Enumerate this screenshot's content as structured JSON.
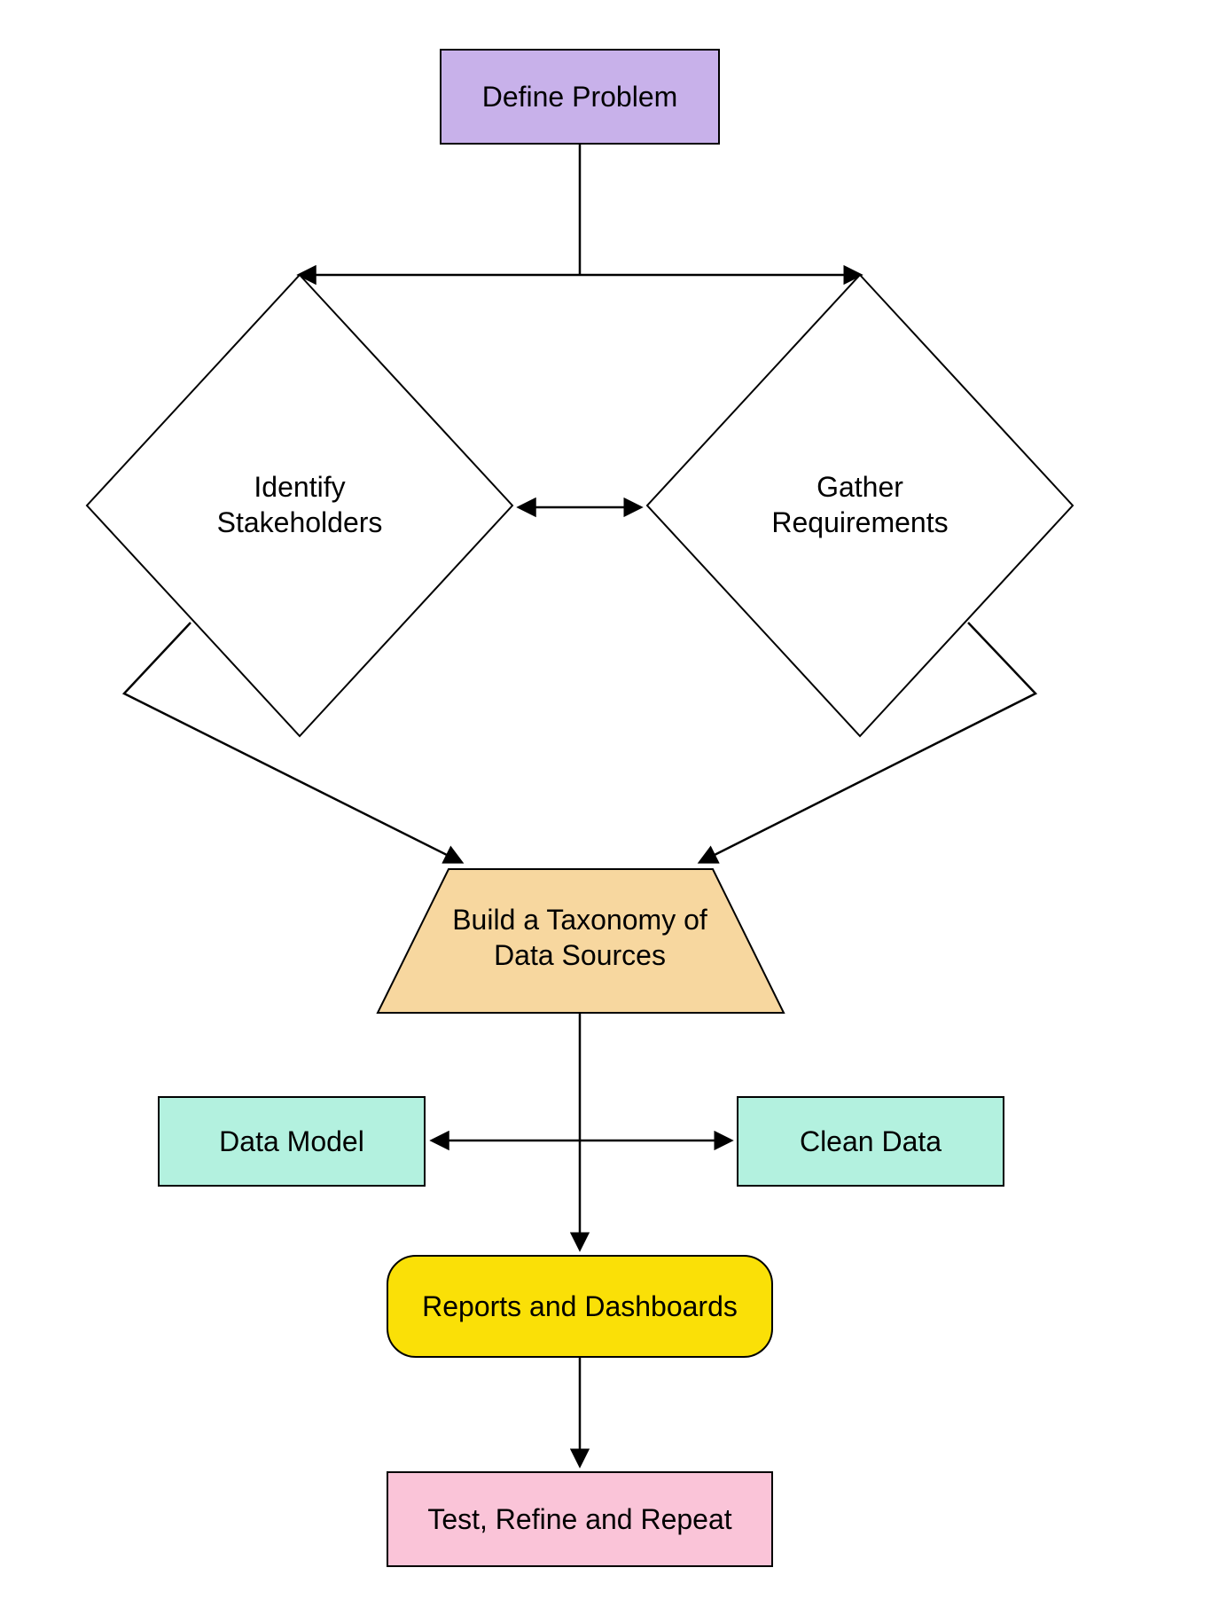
{
  "nodes": {
    "define_problem": {
      "label": "Define Problem",
      "shape": "rect",
      "fill": "#c8b1ea"
    },
    "identify_stakeholders": {
      "label_l1": "Identify",
      "label_l2": "Stakeholders",
      "shape": "diamond",
      "fill": "#ffffff"
    },
    "gather_requirements": {
      "label_l1": "Gather",
      "label_l2": "Requirements",
      "shape": "diamond",
      "fill": "#ffffff"
    },
    "build_taxonomy": {
      "label_l1": "Build a Taxonomy of",
      "label_l2": "Data Sources",
      "shape": "trapezoid",
      "fill": "#f7d79f"
    },
    "data_model": {
      "label": "Data Model",
      "shape": "rect",
      "fill": "#b3f1df"
    },
    "clean_data": {
      "label": "Clean Data",
      "shape": "rect",
      "fill": "#b3f1df"
    },
    "reports_dashboards": {
      "label": "Reports and Dashboards",
      "shape": "roundrect",
      "fill": "#fae007"
    },
    "test_refine_repeat": {
      "label": "Test, Refine and Repeat",
      "shape": "rect",
      "fill": "#fac4d8"
    }
  },
  "edges": [
    {
      "from": "define_problem",
      "to": "identify_stakeholders"
    },
    {
      "from": "define_problem",
      "to": "gather_requirements"
    },
    {
      "from": "identify_stakeholders",
      "to": "gather_requirements",
      "bidirectional": true
    },
    {
      "from": "identify_stakeholders",
      "to": "build_taxonomy"
    },
    {
      "from": "gather_requirements",
      "to": "build_taxonomy"
    },
    {
      "from": "build_taxonomy",
      "to": "reports_dashboards"
    },
    {
      "from": "data_model",
      "to": "clean_data",
      "bidirectional": true
    },
    {
      "from": "reports_dashboards",
      "to": "test_refine_repeat"
    }
  ],
  "colors": {
    "stroke": "#000000"
  }
}
